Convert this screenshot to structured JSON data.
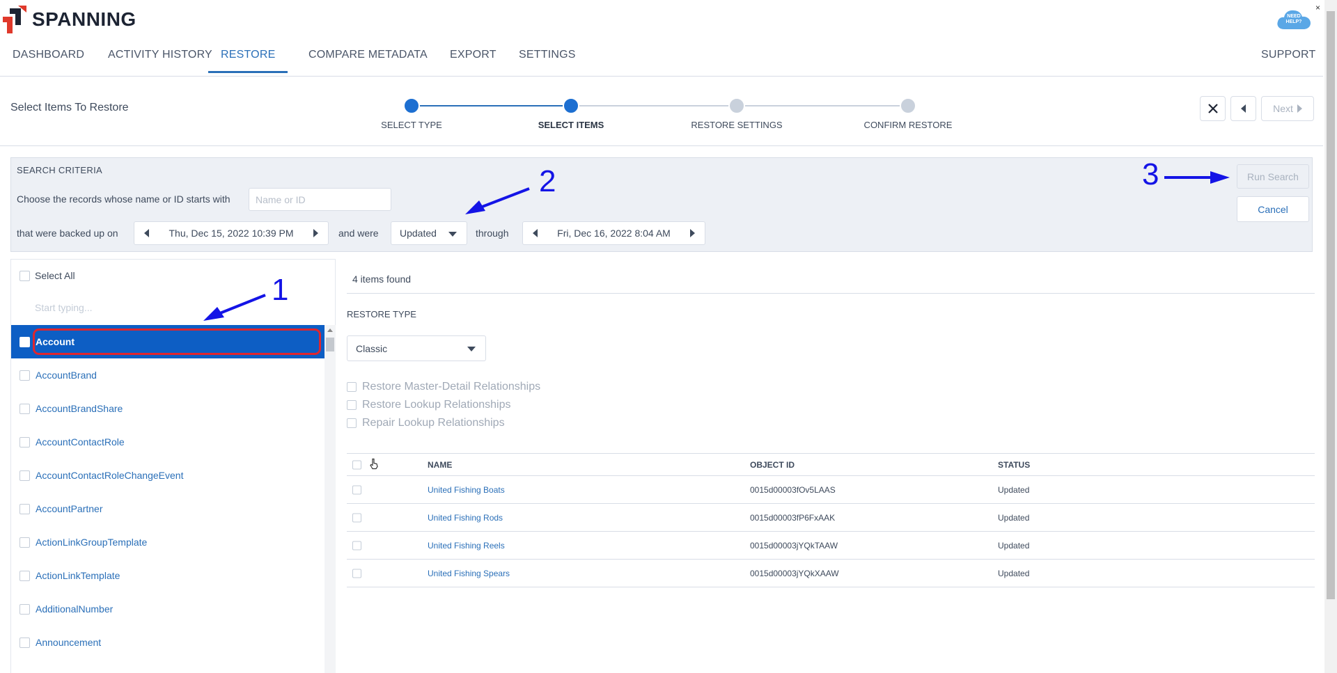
{
  "app": {
    "logo_text": "SPANNING",
    "help_label": "NEED HELP?",
    "help_close": "×"
  },
  "nav": {
    "items": [
      {
        "label": "DASHBOARD"
      },
      {
        "label": "ACTIVITY HISTORY"
      },
      {
        "label": "RESTORE"
      },
      {
        "label": "COMPARE METADATA"
      },
      {
        "label": "EXPORT"
      },
      {
        "label": "SETTINGS"
      }
    ],
    "active": "RESTORE",
    "support": "SUPPORT"
  },
  "stepper": {
    "title": "Select Items To Restore",
    "steps": [
      {
        "label": "SELECT TYPE",
        "state": "done"
      },
      {
        "label": "SELECT ITEMS",
        "state": "current"
      },
      {
        "label": "RESTORE SETTINGS",
        "state": "pending"
      },
      {
        "label": "CONFIRM RESTORE",
        "state": "pending"
      }
    ],
    "close_icon": "close-icon",
    "back_icon": "back-arrow-icon",
    "next_label": "Next"
  },
  "criteria": {
    "title": "SEARCH CRITERIA",
    "name_prompt": "Choose the records whose name or ID starts with",
    "name_placeholder": "Name or ID",
    "backed_up_label": "that were backed up on",
    "backup_date": "Thu, Dec 15, 2022 10:39 PM",
    "and_were_label": "and were",
    "change_type": "Updated",
    "through_label": "through",
    "through_date": "Fri, Dec 16, 2022 8:04 AM",
    "run_search": "Run Search",
    "cancel": "Cancel"
  },
  "annotations": {
    "one": "1",
    "two": "2",
    "three": "3",
    "color": "#1414e6"
  },
  "objects": {
    "select_all": "Select All",
    "filter_placeholder": "Start typing...",
    "items": [
      {
        "label": "Account",
        "selected": true
      },
      {
        "label": "AccountBrand"
      },
      {
        "label": "AccountBrandShare"
      },
      {
        "label": "AccountContactRole"
      },
      {
        "label": "AccountContactRoleChangeEvent"
      },
      {
        "label": "AccountPartner"
      },
      {
        "label": "ActionLinkGroupTemplate"
      },
      {
        "label": "ActionLinkTemplate"
      },
      {
        "label": "AdditionalNumber"
      },
      {
        "label": "Announcement"
      }
    ]
  },
  "results": {
    "count_text": "4 items found",
    "restore_type_label": "RESTORE TYPE",
    "restore_type_value": "Classic",
    "options": [
      {
        "label": "Restore Master-Detail Relationships"
      },
      {
        "label": "Restore Lookup Relationships"
      },
      {
        "label": "Repair Lookup Relationships"
      }
    ],
    "columns": {
      "name": "NAME",
      "object_id": "OBJECT ID",
      "status": "STATUS"
    },
    "rows": [
      {
        "name": "United Fishing Boats",
        "object_id": "0015d00003fOv5LAAS",
        "status": "Updated"
      },
      {
        "name": "United Fishing Rods",
        "object_id": "0015d00003fP6FxAAK",
        "status": "Updated"
      },
      {
        "name": "United Fishing Reels",
        "object_id": "0015d00003jYQkTAAW",
        "status": "Updated"
      },
      {
        "name": "United Fishing Spears",
        "object_id": "0015d00003jYQkXAAW",
        "status": "Updated"
      }
    ]
  },
  "colors": {
    "accent": "#2a6fb8",
    "selected_row": "#0d5ec4",
    "highlight": "#e0262e"
  }
}
